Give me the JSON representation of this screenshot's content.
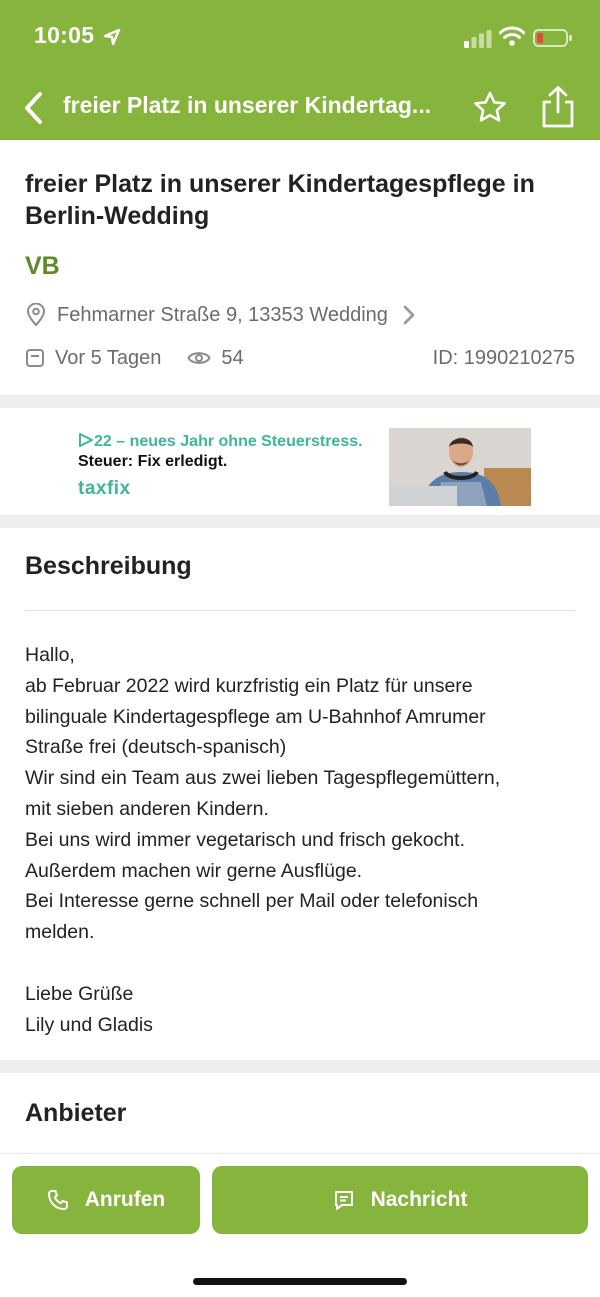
{
  "status_bar": {
    "time": "10:05"
  },
  "nav": {
    "title": "freier Platz in unserer Kindertag..."
  },
  "listing": {
    "title": "freier Platz in unserer Kindertagespflege in Berlin-Wedding",
    "price": "VB",
    "address": "Fehmarner Straße 9, 13353 Wedding",
    "posted": "Vor 5 Tagen",
    "views": "54",
    "id": "ID: 1990210275"
  },
  "ad": {
    "line1": "22 – neues Jahr ohne Steuerstress.",
    "line2": "Steuer: Fix erledigt.",
    "brand": "taxfix"
  },
  "description": {
    "heading": "Beschreibung",
    "lines": [
      "Hallo,",
      "ab Februar 2022 wird kurzfristig ein Platz für unsere",
      "bilinguale Kindertagespflege am U-Bahnhof Amrumer",
      "Straße frei (deutsch-spanisch)",
      "Wir sind ein Team aus zwei lieben Tagespflegemüttern,",
      "mit sieben anderen Kindern.",
      "Bei uns wird immer vegetarisch und frisch gekocht.",
      "Außerdem machen wir gerne Ausflüge.",
      "Bei Interesse gerne schnell per Mail oder telefonisch",
      "melden.",
      "",
      "Liebe Grüße",
      "Lily und Gladis"
    ]
  },
  "provider": {
    "heading": "Anbieter"
  },
  "actions": {
    "call_label": "Anrufen",
    "message_label": "Nachricht"
  },
  "colors": {
    "brand_green": "#86b43c",
    "price_green": "#5f8a2a",
    "ad_teal": "#3fb59a"
  }
}
